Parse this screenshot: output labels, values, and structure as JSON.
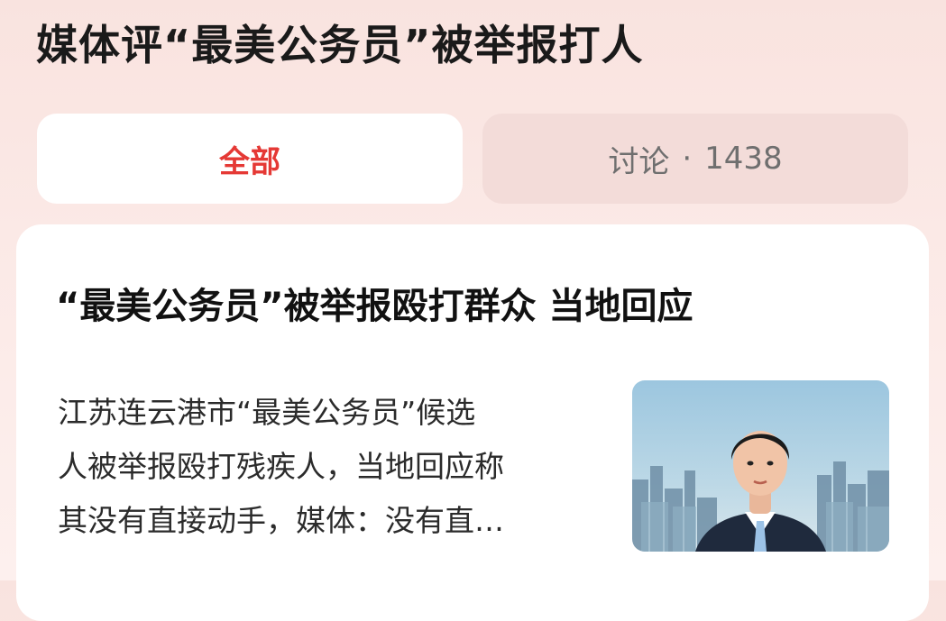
{
  "page_title": "媒体评“最美公务员”被举报打人",
  "tabs": {
    "all_label": "全部",
    "discuss_label": "讨论",
    "separator": "·",
    "discuss_count": "1438"
  },
  "article": {
    "headline": "“最美公务员”被举报殴打群众 当地回应",
    "summary_lines": [
      "江苏连云港市“最美公务员”候选",
      "人被举报殴打残疾人，当地回应称",
      "其没有直接动手，媒体：没有直…"
    ]
  },
  "colors": {
    "accent": "#e53935",
    "background": "#f9e3df",
    "card": "#ffffff",
    "inactive_tab": "#f3dcd9"
  }
}
